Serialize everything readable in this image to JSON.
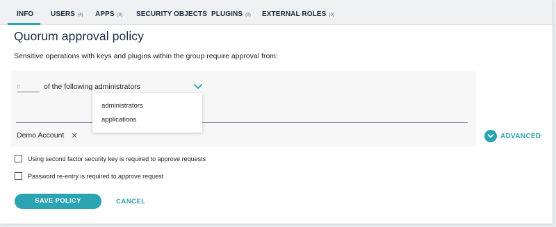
{
  "tabs": [
    {
      "label": "INFO",
      "count": ""
    },
    {
      "label": "USERS",
      "count": "(4)"
    },
    {
      "label": "APPS",
      "count": "(0)"
    },
    {
      "label": "SECURITY OBJECTS",
      "count": ""
    },
    {
      "label": "PLUGINS",
      "count": "(0)"
    },
    {
      "label": "EXTERNAL ROLES",
      "count": "(0)"
    }
  ],
  "active_tab": "INFO",
  "title": "Quorum approval policy",
  "subtitle": "Sensitive operations with keys and plugins within the group require approval from:",
  "policy": {
    "count_placeholder": "#",
    "of_label": "of the following administrators",
    "dropdown_options": [
      "administrators",
      "applications"
    ],
    "selected_chip": "Demo Account"
  },
  "advanced_label": "ADVANCED",
  "checkboxes": [
    {
      "label": "Using second factor security key is required to approve requests",
      "checked": false
    },
    {
      "label": "Password re-entry is required to approve request",
      "checked": false
    }
  ],
  "buttons": {
    "save": "SAVE POLICY",
    "cancel": "CANCEL"
  },
  "colors": {
    "accent": "#2aa3b3",
    "title": "#1a2b44"
  }
}
